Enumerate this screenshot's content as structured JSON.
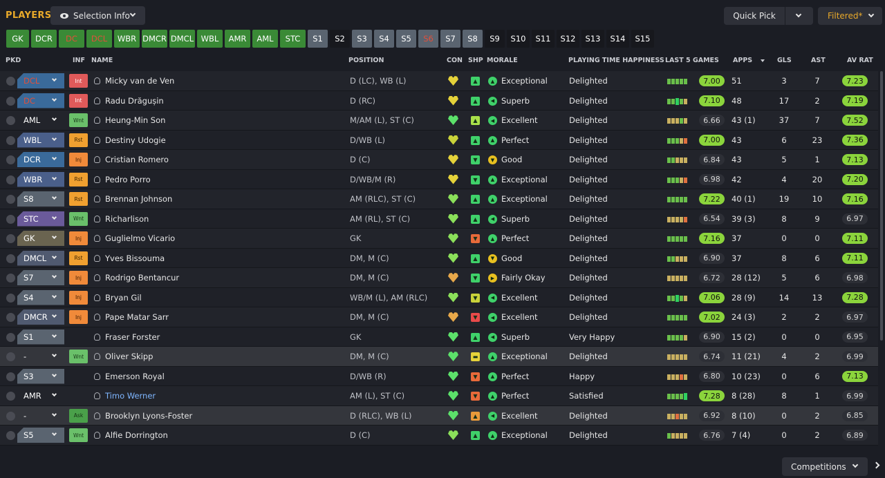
{
  "header": {
    "title": "PLAYERS",
    "selection_info_label": "Selection Info",
    "quick_pick_label": "Quick Pick",
    "filtered_label": "Filtered*"
  },
  "tabs": [
    {
      "label": "GK",
      "style": "g",
      "red": false
    },
    {
      "label": "DCR",
      "style": "g",
      "red": false
    },
    {
      "label": "DC",
      "style": "g",
      "red": true
    },
    {
      "label": "DCL",
      "style": "g",
      "red": true
    },
    {
      "label": "WBR",
      "style": "g",
      "red": false
    },
    {
      "label": "DMCR",
      "style": "g",
      "red": false
    },
    {
      "label": "DMCL",
      "style": "g",
      "red": false
    },
    {
      "label": "WBL",
      "style": "g",
      "red": false
    },
    {
      "label": "AMR",
      "style": "g",
      "red": false
    },
    {
      "label": "AML",
      "style": "g",
      "red": false
    },
    {
      "label": "STC",
      "style": "g",
      "red": false
    },
    {
      "label": "S1",
      "style": "s",
      "red": false
    },
    {
      "label": "S2",
      "style": "k",
      "red": false
    },
    {
      "label": "S3",
      "style": "s",
      "red": false
    },
    {
      "label": "S4",
      "style": "s",
      "red": false
    },
    {
      "label": "S5",
      "style": "s",
      "red": false
    },
    {
      "label": "S6",
      "style": "s",
      "red": true
    },
    {
      "label": "S7",
      "style": "s",
      "red": false
    },
    {
      "label": "S8",
      "style": "s",
      "red": false
    },
    {
      "label": "S9",
      "style": "k",
      "red": false
    },
    {
      "label": "S10",
      "style": "k",
      "red": false
    },
    {
      "label": "S11",
      "style": "k",
      "red": false
    },
    {
      "label": "S12",
      "style": "k",
      "red": false
    },
    {
      "label": "S13",
      "style": "k",
      "red": false
    },
    {
      "label": "S14",
      "style": "k",
      "red": false
    },
    {
      "label": "S15",
      "style": "k",
      "red": false
    }
  ],
  "columns": {
    "pkd": "PKD",
    "inf": "INF",
    "name": "NAME",
    "position": "POSITION",
    "con": "CON",
    "shp": "SHP",
    "morale": "MORALE",
    "pth": "PLAYING TIME HAPPINESS",
    "last5": "LAST 5 GAMES",
    "apps": "APPS",
    "gls": "GLS",
    "ast": "AST",
    "avrat": "AV RAT"
  },
  "players": [
    {
      "sel": "DCL",
      "selColor": "#3a6a9a",
      "selRed": true,
      "inf": "Int",
      "infType": "int",
      "name": "Micky van de Ven",
      "pos": "D (LC), WB (L)",
      "con": "#e5d23a",
      "shp": "#3fd16a",
      "shpIcon": "▲",
      "mor": "#3fd16a",
      "morIcon": "▲",
      "morale": "Exceptional",
      "pth": "Delighted",
      "form": "ggggg",
      "r5": "7.00",
      "r5c": "green",
      "apps": "51",
      "gls": "3",
      "ast": "7",
      "av": "7.23",
      "avc": "green"
    },
    {
      "sel": "DC",
      "selColor": "#3a6a9a",
      "selRed": true,
      "inf": "Int",
      "infType": "int",
      "name": "Radu Drăgușin",
      "pos": "D (RC)",
      "con": "#e5d23a",
      "shp": "#3fd16a",
      "shpIcon": "▲",
      "mor": "#3fd16a",
      "morIcon": "◀",
      "morale": "Superb",
      "pth": "Delighted",
      "form": "ggbgy",
      "r5": "7.10",
      "r5c": "green",
      "apps": "48",
      "gls": "17",
      "ast": "2",
      "av": "7.19",
      "avc": "green"
    },
    {
      "sel": "AML",
      "selColor": "#22242b",
      "selRed": false,
      "inf": "Wnt",
      "infType": "wnt",
      "name": "Heung-Min Son",
      "pos": "M/AM (L), ST (C)",
      "con": "#5ce16a",
      "shp": "#a9e04a",
      "shpIcon": "▲",
      "mor": "#3fd16a",
      "morIcon": "◀",
      "morale": "Excellent",
      "pth": "Delighted",
      "form": "yyygy",
      "r5": "6.66",
      "r5c": "grey",
      "apps": "43 (1)",
      "gls": "37",
      "ast": "7",
      "av": "7.52",
      "avc": "green"
    },
    {
      "sel": "WBL",
      "selColor": "#4a5f8a",
      "selRed": false,
      "inf": "Rst",
      "infType": "rst",
      "name": "Destiny Udogie",
      "pos": "D/WB (L)",
      "con": "#c9d23a",
      "shp": "#3fd16a",
      "shpIcon": "▲",
      "mor": "#3fd16a",
      "morIcon": "▲",
      "morale": "Perfect",
      "pth": "Delighted",
      "form": "gggyo",
      "r5": "7.00",
      "r5c": "green",
      "apps": "43",
      "gls": "6",
      "ast": "23",
      "av": "7.36",
      "avc": "green"
    },
    {
      "sel": "DCR",
      "selColor": "#3a6a9a",
      "selRed": false,
      "inf": "Inj",
      "infType": "inj",
      "name": "Cristian Romero",
      "pos": "D (C)",
      "con": "#e5d23a",
      "shp": "#3fd16a",
      "shpIcon": "▼",
      "mor": "#e8c020",
      "morIcon": "▼",
      "morale": "Good",
      "pth": "Delighted",
      "form": "ggyyy",
      "r5": "6.84",
      "r5c": "grey",
      "apps": "43",
      "gls": "5",
      "ast": "1",
      "av": "7.13",
      "avc": "green"
    },
    {
      "sel": "WBR",
      "selColor": "#4a5f8a",
      "selRed": false,
      "inf": "Rst",
      "infType": "rst",
      "name": "Pedro Porro",
      "pos": "D/WB/M (R)",
      "con": "#e5d23a",
      "shp": "#3fd16a",
      "shpIcon": "▼",
      "mor": "#3fd16a",
      "morIcon": "▲",
      "morale": "Exceptional",
      "pth": "Delighted",
      "form": "gggyo",
      "r5": "6.98",
      "r5c": "grey",
      "apps": "42",
      "gls": "4",
      "ast": "20",
      "av": "7.20",
      "avc": "green"
    },
    {
      "sel": "S8",
      "selColor": "#5a6470",
      "selRed": false,
      "inf": "Rst",
      "infType": "rst",
      "name": "Brennan Johnson",
      "pos": "AM (RLC), ST (C)",
      "con": "#8be05a",
      "shp": "#3fd16a",
      "shpIcon": "▲",
      "mor": "#3fd16a",
      "morIcon": "▲",
      "morale": "Exceptional",
      "pth": "Delighted",
      "form": "ggggg",
      "r5": "7.22",
      "r5c": "green",
      "apps": "40 (1)",
      "gls": "19",
      "ast": "10",
      "av": "7.16",
      "avc": "green"
    },
    {
      "sel": "STC",
      "selColor": "#6a5a9a",
      "selRed": false,
      "inf": "Wnt",
      "infType": "wnt",
      "name": "Richarlison",
      "pos": "AM (RL), ST (C)",
      "con": "#8be05a",
      "shp": "#3fd16a",
      "shpIcon": "▲",
      "mor": "#3fd16a",
      "morIcon": "◀",
      "morale": "Superb",
      "pth": "Delighted",
      "form": "yyyyo",
      "r5": "6.54",
      "r5c": "grey",
      "apps": "39 (3)",
      "gls": "8",
      "ast": "9",
      "av": "6.97",
      "avc": "grey"
    },
    {
      "sel": "GK",
      "selColor": "#6a6450",
      "selRed": false,
      "inf": "Inj",
      "infType": "inj",
      "name": "Guglielmo Vicario",
      "pos": "GK",
      "con": "#8be05a",
      "shp": "#e86a3a",
      "shpIcon": "▼",
      "mor": "#3fd16a",
      "morIcon": "▲",
      "morale": "Perfect",
      "pth": "Delighted",
      "form": "ggggg",
      "r5": "7.16",
      "r5c": "green",
      "apps": "37",
      "gls": "0",
      "ast": "0",
      "av": "7.11",
      "avc": "green"
    },
    {
      "sel": "DMCL",
      "selColor": "#505a70",
      "selRed": false,
      "inf": "Rst",
      "infType": "rst",
      "name": "Yves Bissouma",
      "pos": "DM, M (C)",
      "con": "#8be05a",
      "shp": "#3fd16a",
      "shpIcon": "▲",
      "mor": "#e8c020",
      "morIcon": "▼",
      "morale": "Good",
      "pth": "Delighted",
      "form": "ggyyy",
      "r5": "6.90",
      "r5c": "grey",
      "apps": "37",
      "gls": "8",
      "ast": "6",
      "av": "7.11",
      "avc": "green"
    },
    {
      "sel": "S7",
      "selColor": "#5a6470",
      "selRed": false,
      "inf": "Inj",
      "infType": "inj",
      "name": "Rodrigo Bentancur",
      "pos": "DM, M (C)",
      "con": "#e8a84a",
      "shp": "#3fd16a",
      "shpIcon": "▼",
      "mor": "#e8c020",
      "morIcon": "▶",
      "morale": "Fairly Okay",
      "pth": "Delighted",
      "form": "yyyyy",
      "r5": "6.72",
      "r5c": "grey",
      "apps": "28 (12)",
      "gls": "5",
      "ast": "6",
      "av": "6.98",
      "avc": "grey"
    },
    {
      "sel": "S4",
      "selColor": "#5a6470",
      "selRed": false,
      "inf": "Inj",
      "infType": "inj",
      "name": "Bryan Gil",
      "pos": "WB/M (L), AM (RLC)",
      "con": "#8be05a",
      "shp": "#c9d23a",
      "shpIcon": "▼",
      "mor": "#3fd16a",
      "morIcon": "◀",
      "morale": "Excellent",
      "pth": "Delighted",
      "form": "ggbgy",
      "r5": "7.06",
      "r5c": "green",
      "apps": "28 (9)",
      "gls": "14",
      "ast": "13",
      "av": "7.28",
      "avc": "green"
    },
    {
      "sel": "DMCR",
      "selColor": "#505a70",
      "selRed": false,
      "inf": "Inj",
      "infType": "inj",
      "name": "Pape Matar Sarr",
      "pos": "DM, M (C)",
      "con": "#e8a84a",
      "shp": "#e84a4a",
      "shpIcon": "▼",
      "mor": "#3fd16a",
      "morIcon": "◀",
      "morale": "Excellent",
      "pth": "Delighted",
      "form": "ggggg",
      "r5": "7.02",
      "r5c": "green",
      "apps": "24 (3)",
      "gls": "2",
      "ast": "2",
      "av": "6.97",
      "avc": "grey"
    },
    {
      "sel": "S1",
      "selColor": "#5a6470",
      "selRed": false,
      "inf": "",
      "infType": "",
      "name": "Fraser Forster",
      "pos": "GK",
      "con": "#5ce16a",
      "shp": "#3fd16a",
      "shpIcon": "▲",
      "mor": "#3fd16a",
      "morIcon": "◀",
      "morale": "Superb",
      "pth": "Very Happy",
      "form": "ggggy",
      "r5": "6.90",
      "r5c": "grey",
      "apps": "15 (2)",
      "gls": "0",
      "ast": "0",
      "av": "6.95",
      "avc": "grey"
    },
    {
      "sel": "-",
      "selColor": "#34363c",
      "selRed": false,
      "inf": "Wnt",
      "infType": "wnt",
      "name": "Oliver Skipp",
      "pos": "DM, M (C)",
      "con": "#5ce16a",
      "shp": "#e5d23a",
      "shpIcon": "▬",
      "mor": "#3fd16a",
      "morIcon": "▲",
      "morale": "Exceptional",
      "pth": "Delighted",
      "form": "yyyyy",
      "r5": "6.74",
      "r5c": "grey",
      "apps": "11 (21)",
      "gls": "4",
      "ast": "2",
      "av": "6.99",
      "avc": "grey",
      "hl": true
    },
    {
      "sel": "S3",
      "selColor": "#5a6470",
      "selRed": false,
      "inf": "",
      "infType": "",
      "name": "Emerson Royal",
      "pos": "D/WB (R)",
      "con": "#5ce16a",
      "shp": "#e86a3a",
      "shpIcon": "▼",
      "mor": "#3fd16a",
      "morIcon": "▲",
      "morale": "Perfect",
      "pth": "Happy",
      "form": "yyyoy",
      "r5": "6.80",
      "r5c": "grey",
      "apps": "10 (23)",
      "gls": "0",
      "ast": "6",
      "av": "7.13",
      "avc": "green"
    },
    {
      "sel": "AMR",
      "selColor": "#22242b",
      "selRed": false,
      "inf": "",
      "infType": "",
      "name": "Timo Werner",
      "pos": "AM (L), ST (C)",
      "con": "#5ce16a",
      "shp": "#e86a3a",
      "shpIcon": "▼",
      "mor": "#3fd16a",
      "morIcon": "▲",
      "morale": "Perfect",
      "pth": "Satisfied",
      "form": "ggggb",
      "r5": "7.28",
      "r5c": "green",
      "apps": "8 (28)",
      "gls": "8",
      "ast": "1",
      "av": "6.99",
      "avc": "grey",
      "blue": true
    },
    {
      "sel": "-",
      "selColor": "#34363c",
      "selRed": false,
      "inf": "Ask",
      "infType": "ask",
      "name": "Brooklyn Lyons-Foster",
      "pos": "D (RLC), WB (L)",
      "con": "#5ce16a",
      "shp": "#e89a3a",
      "shpIcon": "▲",
      "mor": "#3fd16a",
      "morIcon": "◀",
      "morale": "Excellent",
      "pth": "Delighted",
      "form": "yyoyy",
      "r5": "6.92",
      "r5c": "grey",
      "apps": "8 (10)",
      "gls": "0",
      "ast": "2",
      "av": "6.85",
      "avc": "grey",
      "hl": true
    },
    {
      "sel": "S5",
      "selColor": "#5a6470",
      "selRed": false,
      "inf": "Wnt",
      "infType": "wnt",
      "name": "Alfie Dorrington",
      "pos": "D (C)",
      "con": "#8be05a",
      "shp": "#3fd16a",
      "shpIcon": "▲",
      "mor": "#3fd16a",
      "morIcon": "▲",
      "morale": "Exceptional",
      "pth": "Delighted",
      "form": "gyyyy",
      "r5": "6.76",
      "r5c": "grey",
      "apps": "7 (4)",
      "gls": "0",
      "ast": "2",
      "av": "6.89",
      "avc": "grey"
    }
  ],
  "footer": {
    "competitions_label": "Competitions"
  }
}
